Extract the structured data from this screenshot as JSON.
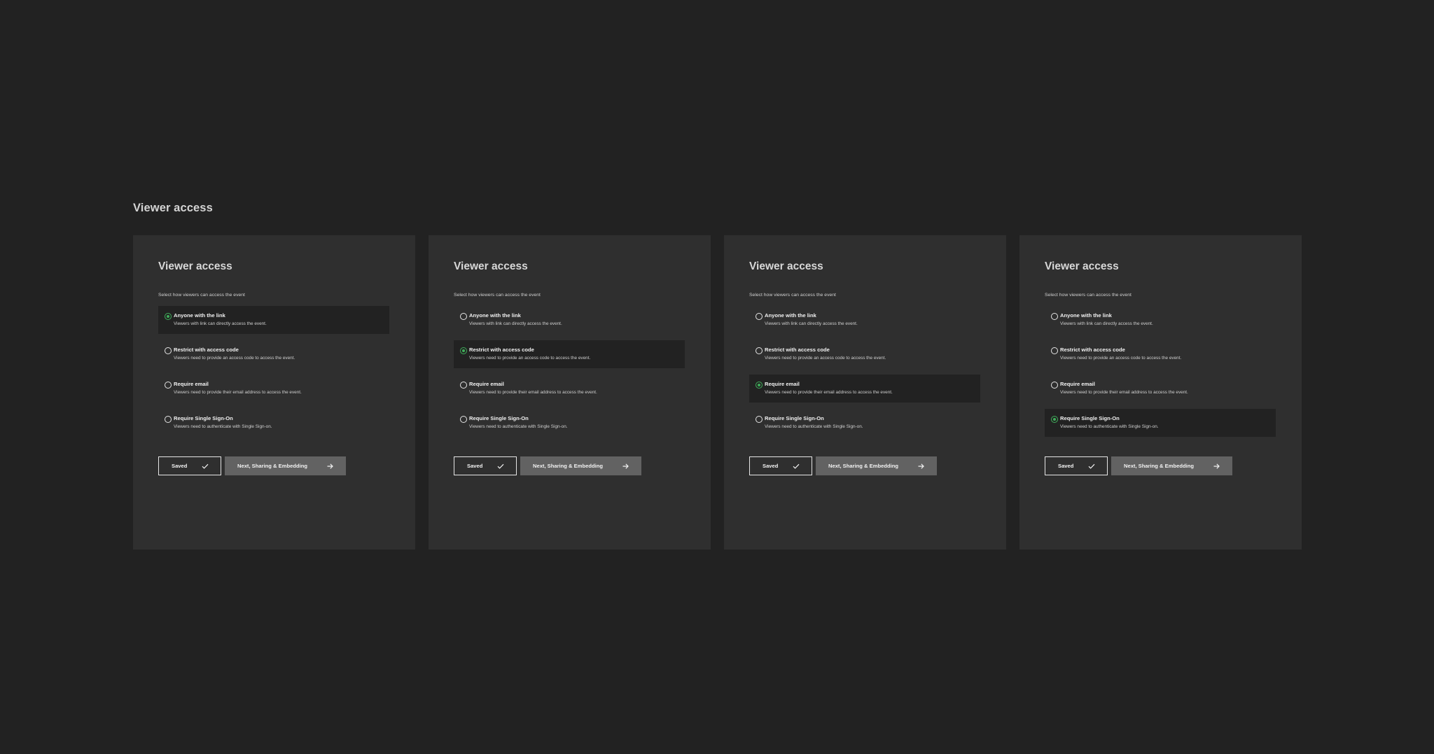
{
  "page": {
    "heading": "Viewer access"
  },
  "colors": {
    "background": "#222222",
    "panel": "#2f2f2f",
    "selected_row": "#222222",
    "accent_green": "#3fae5a",
    "next_button": "#626262"
  },
  "panels": [
    {
      "title": "Viewer access",
      "subtitle": "Select how viewers can access the event",
      "selected_index": 0,
      "options": [
        {
          "label": "Anyone with the link",
          "description": "Viewers with link can directly access the event."
        },
        {
          "label": "Restrict with access code",
          "description": "Viewers need to provide an access code to access the event."
        },
        {
          "label": "Require email",
          "description": "Viewers need to provide their email address to access the event."
        },
        {
          "label": "Require Single Sign-On",
          "description": "Viewers need to authenticate with Single Sign-on."
        }
      ],
      "saved_label": "Saved",
      "next_label": "Next, Sharing & Embedding",
      "saved_icon": "check-icon",
      "next_icon": "arrow-right-icon"
    },
    {
      "title": "Viewer access",
      "subtitle": "Select how viewers can access the event",
      "selected_index": 1,
      "options": [
        {
          "label": "Anyone with the link",
          "description": "Viewers with link can directly access the event."
        },
        {
          "label": "Restrict with access code",
          "description": "Viewers need to provide an access code to access the event."
        },
        {
          "label": "Require email",
          "description": "Viewers need to provide their email address to access the event."
        },
        {
          "label": "Require Single Sign-On",
          "description": "Viewers need to authenticate with Single Sign-on."
        }
      ],
      "saved_label": "Saved",
      "next_label": "Next, Sharing & Embedding",
      "saved_icon": "check-icon",
      "next_icon": "arrow-right-icon"
    },
    {
      "title": "Viewer access",
      "subtitle": "Select how viewers can access the event",
      "selected_index": 2,
      "options": [
        {
          "label": "Anyone with the link",
          "description": "Viewers with link can directly access the event."
        },
        {
          "label": "Restrict with access code",
          "description": "Viewers need to provide an access code to access the event."
        },
        {
          "label": "Require email",
          "description": "Viewers need to provide their email address to access the event."
        },
        {
          "label": "Require Single Sign-On",
          "description": "Viewers need to authenticate with Single Sign-on."
        }
      ],
      "saved_label": "Saved",
      "next_label": "Next, Sharing & Embedding",
      "saved_icon": "check-icon",
      "next_icon": "arrow-right-icon"
    },
    {
      "title": "Viewer access",
      "subtitle": "Select how viewers can access the event",
      "selected_index": 3,
      "options": [
        {
          "label": "Anyone with the link",
          "description": "Viewers with link can directly access the event."
        },
        {
          "label": "Restrict with access code",
          "description": "Viewers need to provide an access code to access the event."
        },
        {
          "label": "Require email",
          "description": "Viewers need to provide their email address to access the event."
        },
        {
          "label": "Require Single Sign-On",
          "description": "Viewers need to authenticate with Single Sign-on."
        }
      ],
      "saved_label": "Saved",
      "next_label": "Next, Sharing & Embedding",
      "saved_icon": "check-icon",
      "next_icon": "arrow-right-icon"
    }
  ]
}
